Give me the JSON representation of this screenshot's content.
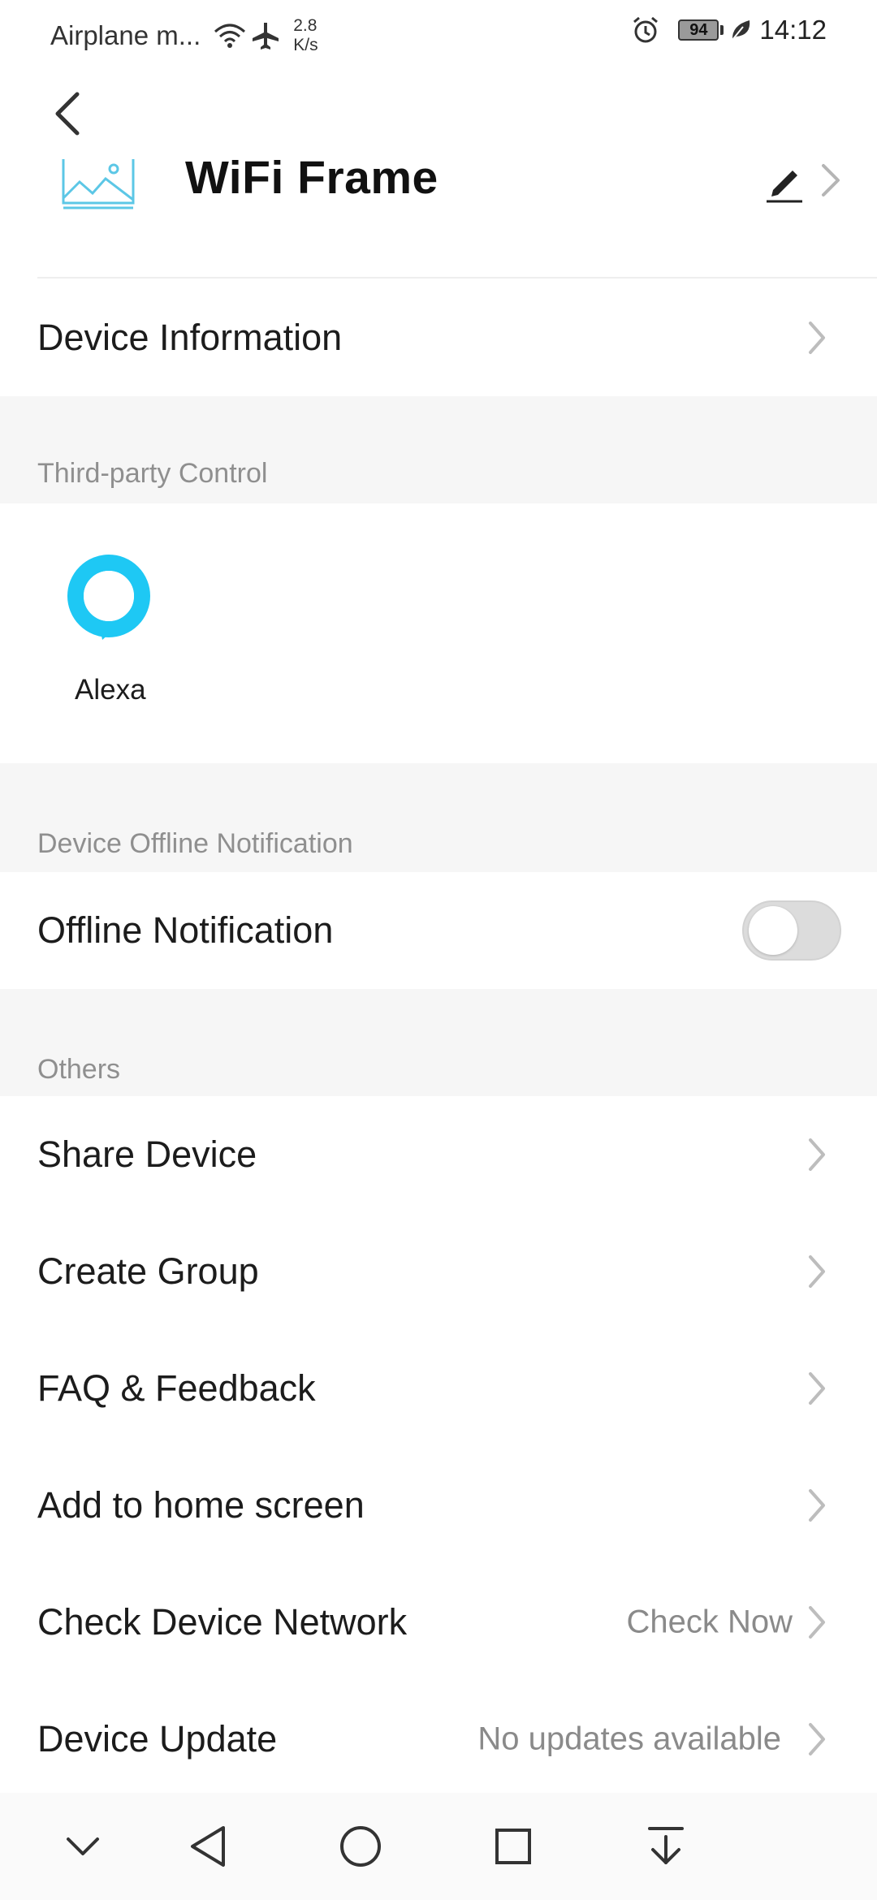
{
  "status_bar": {
    "carrier": "Airplane m...",
    "speed_value": "2.8",
    "speed_unit": "K/s",
    "battery": "94",
    "time": "14:12"
  },
  "header": {
    "title": "WiFi Frame"
  },
  "device_information": {
    "label": "Device Information"
  },
  "third_party": {
    "section_title": "Third-party Control",
    "alexa_label": "Alexa"
  },
  "offline": {
    "section_title": "Device Offline Notification",
    "label": "Offline Notification",
    "enabled": false
  },
  "others": {
    "section_title": "Others",
    "items": [
      {
        "label": "Share Device",
        "value": ""
      },
      {
        "label": "Create Group",
        "value": ""
      },
      {
        "label": "FAQ & Feedback",
        "value": ""
      },
      {
        "label": "Add to home screen",
        "value": ""
      },
      {
        "label": "Check Device Network",
        "value": "Check Now"
      },
      {
        "label": "Device Update",
        "value": "No updates available"
      }
    ]
  },
  "colors": {
    "alexa_blue": "#1ec8f4",
    "device_icon": "#5cc7e6",
    "section_bg": "#f6f6f6",
    "secondary_text": "#8a8a8a"
  },
  "icons": {
    "status": [
      "wifi-icon",
      "airplane-icon",
      "alarm-icon",
      "battery-icon",
      "leaf-icon"
    ],
    "nav": [
      "collapse-down-icon",
      "back-triangle-icon",
      "home-circle-icon",
      "recents-square-icon",
      "notification-pull-icon"
    ]
  }
}
